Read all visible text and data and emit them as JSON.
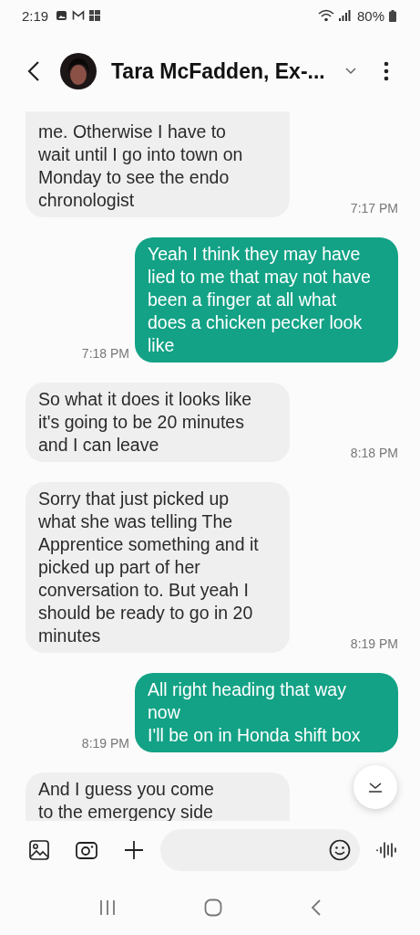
{
  "status_bar": {
    "time": "2:19",
    "battery": "80%"
  },
  "header": {
    "contact": "Tara McFadden, Ex-..."
  },
  "messages": [
    {
      "kind": "incoming",
      "text": "me. Otherwise I have to wait until I go into town on Monday to see the endo chronologist",
      "time": "7:17 PM",
      "cut_top": true
    },
    {
      "kind": "outgoing",
      "text": "Yeah I think they may have lied to me that may not have been a finger at all what does a chicken pecker look like",
      "time": "7:18 PM"
    },
    {
      "kind": "incoming",
      "text": "So what it does it looks like it's going to be 20 minutes and I can leave",
      "time": "8:18 PM"
    },
    {
      "kind": "incoming",
      "text": "Sorry that just picked up what she was telling The Apprentice something and it picked up part of her conversation to. But yeah I should be ready to go in 20 minutes",
      "time": "8:19 PM"
    },
    {
      "kind": "outgoing",
      "text": "All right heading that way now\nI'll be on in Honda shift box",
      "time": "8:19 PM"
    },
    {
      "kind": "incoming",
      "text": "And I guess you come\nto the emergency side",
      "cut_bottom": true
    }
  ]
}
